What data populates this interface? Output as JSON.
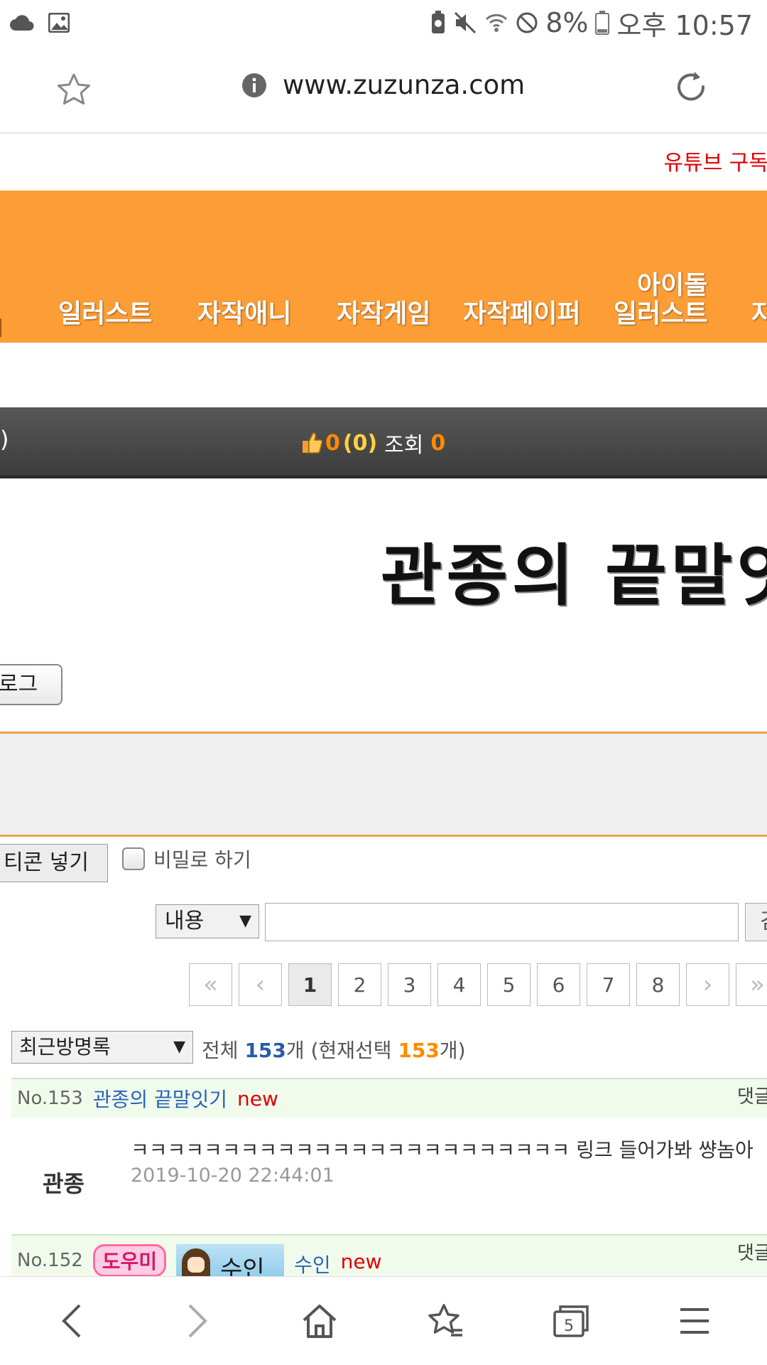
{
  "status_bar": {
    "battery_percent": "8%",
    "time": "오후 10:57"
  },
  "browser": {
    "url": "www.zuzunza.com"
  },
  "page": {
    "top_link": "유튜브 구독",
    "menu": [
      {
        "label": "일러스트"
      },
      {
        "label": "자작애니"
      },
      {
        "label": "자작게임"
      },
      {
        "label": "자작페이퍼"
      },
      {
        "label_line1": "아이돌",
        "label_line2": "일러스트"
      },
      {
        "label": "자"
      }
    ],
    "info": {
      "paren": ")",
      "likes": "0",
      "likes_paren": "(0)",
      "views_label": "조회",
      "views": "0"
    },
    "title": "관종의 끝말잇",
    "log_button": "로그",
    "emoticon_button": "티콘 넣기",
    "secret_label": "비밀로 하기",
    "search": {
      "field_select": "내용",
      "button_partial": "검"
    },
    "pagination": {
      "first": "«",
      "prev": "‹",
      "pages": [
        "1",
        "2",
        "3",
        "4",
        "5",
        "6",
        "7",
        "8"
      ],
      "current": "1",
      "next": "›",
      "last": "»"
    },
    "filter": {
      "select": "최근방명록",
      "total_label": "전체",
      "total": "153",
      "unit": "개",
      "selected_label": "(현재선택",
      "selected": "153",
      "selected_unit": "개)"
    },
    "entries": [
      {
        "no": "No.153",
        "title": "관종의 끝말잇기",
        "new": "new",
        "reply": "댓글",
        "author": "관종",
        "content": "ㅋㅋㅋㅋㅋㅋㅋㅋㅋㅋㅋㅋㅋㅋㅋㅋㅋㅋㅋㅋㅋㅋㅋㅋ 링크 들어가봐 썅놈아",
        "date": "2019-10-20 22:44:01"
      },
      {
        "no": "No.152",
        "badge": "도우미",
        "nick_image_text": "수인",
        "title": "수인",
        "new": "new",
        "reply": "댓글"
      }
    ]
  },
  "navbar": {
    "tab_count": "5"
  },
  "colors": {
    "banner": "#fd9d36",
    "link_red": "#e00000",
    "accent_orange": "#ff8a00",
    "blue": "#2a5aa8"
  }
}
